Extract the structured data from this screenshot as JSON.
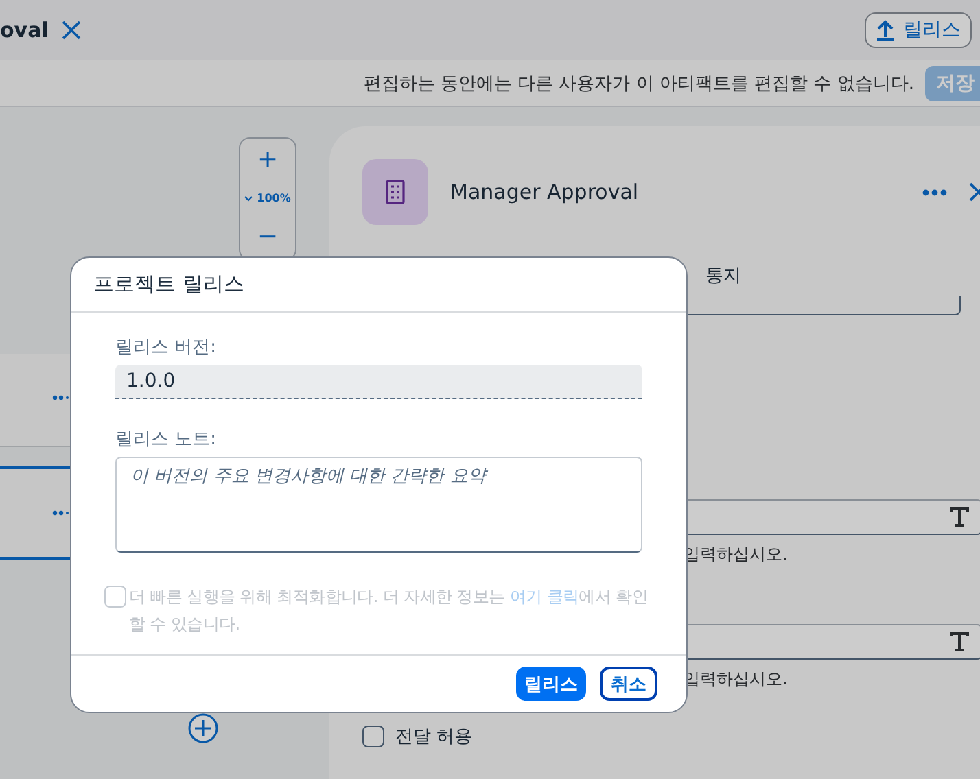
{
  "header": {
    "title": "oval",
    "release_button": "릴리스"
  },
  "info_bar": {
    "message": "편집하는 동안에는 다른 사용자가 이 아티팩트를 편집할 수 없습니다.",
    "save_button": "저장"
  },
  "zoom": {
    "plus": "+",
    "level": "100%",
    "minus": "−"
  },
  "canvas_nodes": [
    {
      "selected": false
    },
    {
      "selected": true
    }
  ],
  "panel": {
    "title": "Manager Approval",
    "tabs": [
      {
        "label": "통지",
        "selected": false
      }
    ],
    "fields": [
      {
        "hint": "입력하십시오."
      },
      {
        "hint": "입력하십시오."
      }
    ],
    "forward": {
      "label": "전달 허용",
      "checked": false
    }
  },
  "dialog": {
    "title": "프로젝트 릴리스",
    "version_label": "릴리스 버전:",
    "version_value": "1.0.0",
    "notes_label": "릴리스 노트:",
    "notes_placeholder": "이 버전의 주요 변경사항에 대한 간략한 요약",
    "optimize": {
      "text_before": "더 빠른 실행을 위해 최적화합니다. 더 자세한 정보는 ",
      "link": "여기 클릭",
      "text_after": "에서 확인할 수 있습니다.",
      "checked": false,
      "disabled": true
    },
    "buttons": [
      {
        "label": "릴리스",
        "kind": "primary"
      },
      {
        "label": "취소",
        "kind": "secondary"
      }
    ]
  }
}
